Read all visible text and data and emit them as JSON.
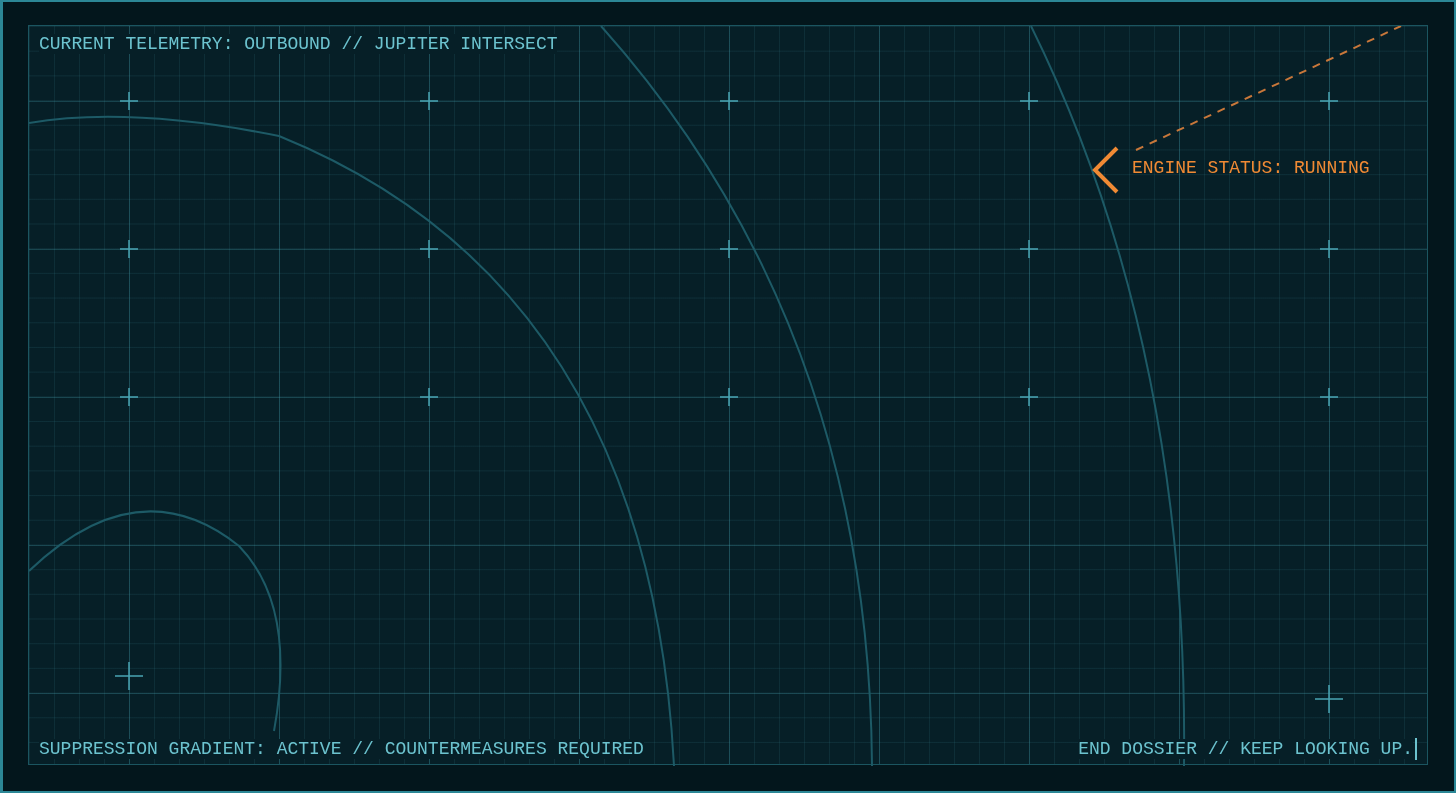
{
  "telemetry": "CURRENT TELEMETRY: OUTBOUND // JUPITER INTERSECT",
  "callout": {
    "text": "ENGINE STATUS: RUNNING"
  },
  "footer_left": "SUPPRESSION GRADIENT: ACTIVE // COUNTERMEASURES REQUIRED",
  "footer_right": "END DOSSIER // KEEP LOOKING UP."
}
